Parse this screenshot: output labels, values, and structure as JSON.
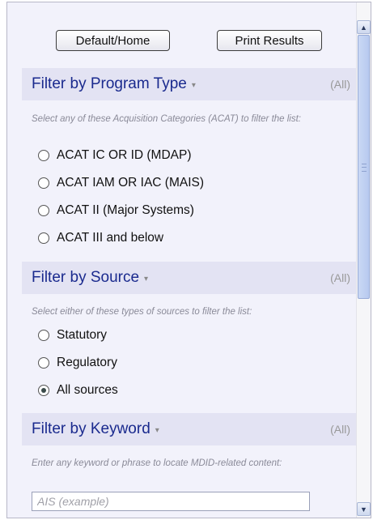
{
  "buttons": {
    "home": "Default/Home",
    "print": "Print Results"
  },
  "program_type": {
    "title": "Filter by Program Type",
    "caret": "▾",
    "status": "(All)",
    "hint": "Select any of these Acquisition Categories (ACAT) to filter the list:",
    "options": [
      "ACAT IC OR ID (MDAP)",
      "ACAT IAM OR IAC (MAIS)",
      "ACAT II (Major Systems)",
      "ACAT III and below"
    ],
    "selected": null
  },
  "source": {
    "title": "Filter by Source",
    "caret": "▾",
    "status": "(All)",
    "hint": "Select either of these types of sources to filter the list:",
    "options": [
      "Statutory",
      "Regulatory",
      "All sources"
    ],
    "selected": "All sources"
  },
  "keyword": {
    "title": "Filter by Keyword",
    "caret": "▾",
    "status": "(All)",
    "hint": "Enter any keyword or phrase to locate MDID-related content:",
    "placeholder": "AIS (example)",
    "value": ""
  },
  "scrollbar": {
    "up_icon": "▲",
    "down_icon": "▼"
  }
}
